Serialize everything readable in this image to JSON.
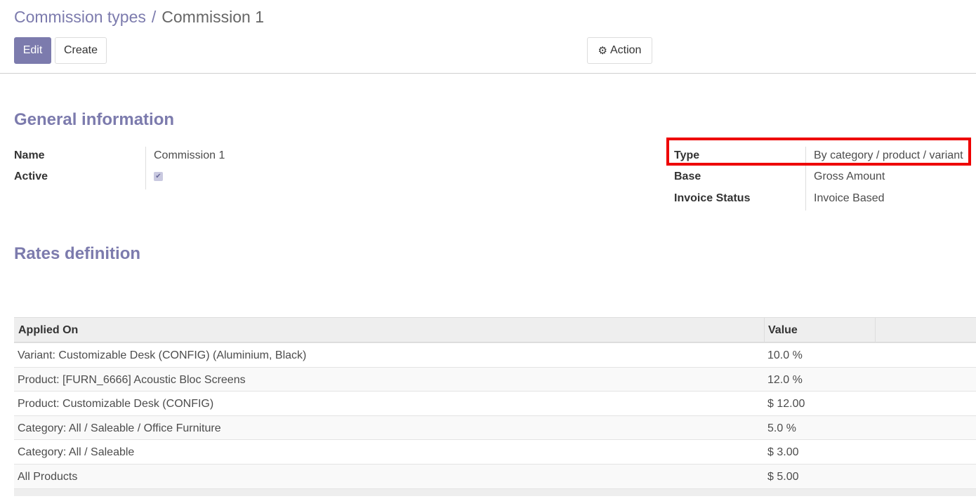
{
  "breadcrumb": {
    "parent": "Commission types",
    "separator": "/",
    "current": "Commission 1"
  },
  "toolbar": {
    "edit_label": "Edit",
    "create_label": "Create",
    "action_label": "Action",
    "action_icon": "gear-icon"
  },
  "general": {
    "title": "General information",
    "name_label": "Name",
    "name_value": "Commission 1",
    "active_label": "Active",
    "active_checked": true,
    "type_label": "Type",
    "type_value": "By category / product / variant",
    "base_label": "Base",
    "base_value": "Gross Amount",
    "invoice_status_label": "Invoice Status",
    "invoice_status_value": "Invoice Based"
  },
  "rates": {
    "title": "Rates definition",
    "columns": [
      "Applied On",
      "Value"
    ],
    "rows": [
      {
        "applied_on": "Variant: Customizable Desk (CONFIG) (Aluminium, Black)",
        "value": "10.0 %"
      },
      {
        "applied_on": "Product: [FURN_6666] Acoustic Bloc Screens",
        "value": "12.0 %"
      },
      {
        "applied_on": "Product: Customizable Desk (CONFIG)",
        "value": "$ 12.00"
      },
      {
        "applied_on": "Category: All / Saleable / Office Furniture",
        "value": "5.0 %"
      },
      {
        "applied_on": "Category: All / Saleable",
        "value": "$ 3.00"
      },
      {
        "applied_on": "All Products",
        "value": "$ 5.00"
      }
    ]
  },
  "colors": {
    "accent": "#7c7bad",
    "highlight_border": "#ee0000"
  }
}
